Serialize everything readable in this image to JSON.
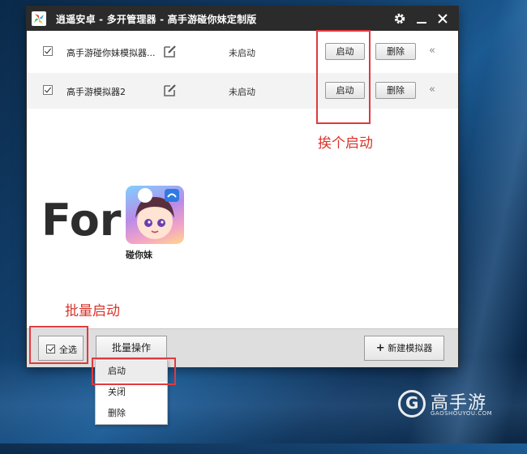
{
  "window": {
    "title": "逍遥安卓 - 多开管理器 - 高手游碰你妹定制版",
    "settings_icon": "gear-icon",
    "minimize_icon": "minimize-icon",
    "close_icon": "close-icon"
  },
  "emulators": [
    {
      "checked": true,
      "name": "高手游碰你妹模拟器...",
      "status": "未启动",
      "start_label": "启动",
      "delete_label": "删除"
    },
    {
      "checked": true,
      "name": "高手游模拟器2",
      "status": "未启动",
      "start_label": "启动",
      "delete_label": "删除"
    }
  ],
  "promo": {
    "for_text": "For",
    "game_name": "碰你妹"
  },
  "annotations": {
    "one_by_one": "挨个启动",
    "batch": "批量启动",
    "color": "#d9342b"
  },
  "bottombar": {
    "select_all_label": "全选",
    "select_all_checked": true,
    "batch_label": "批量操作",
    "new_emulator_label": "新建模拟器"
  },
  "batch_menu": [
    "启动",
    "关闭",
    "删除"
  ],
  "watermark": {
    "name": "高手游",
    "url": "GAOSHOUYOU.COM"
  }
}
